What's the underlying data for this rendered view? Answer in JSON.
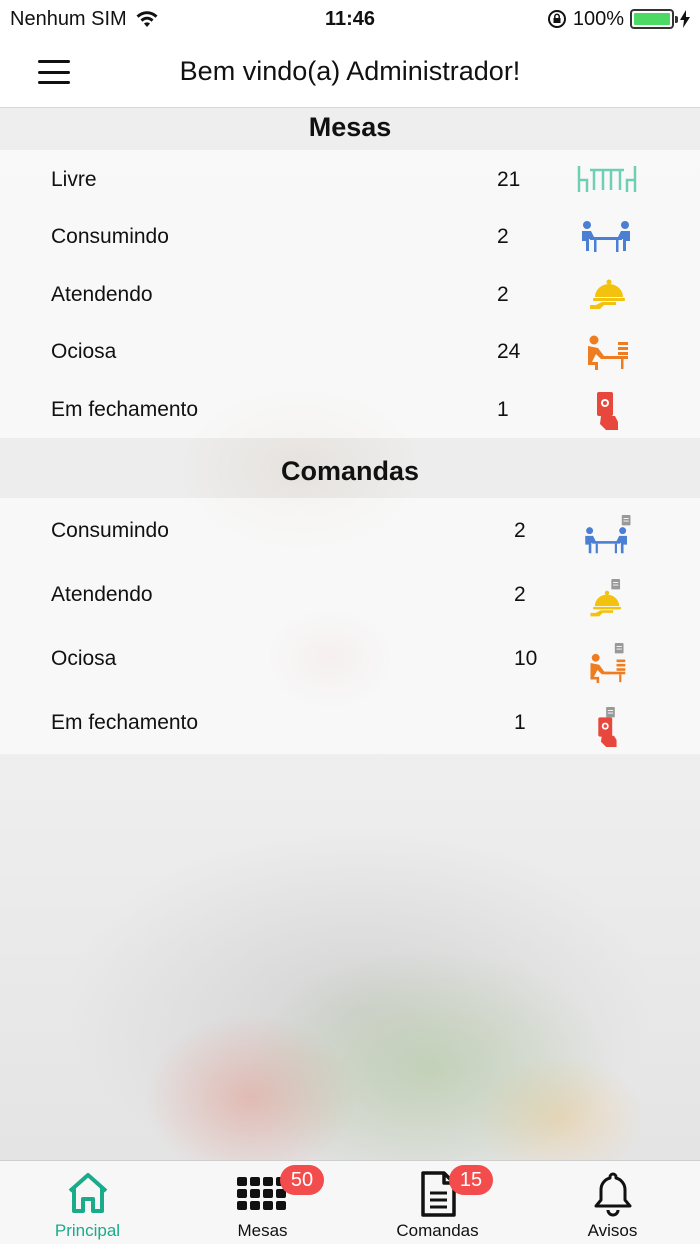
{
  "status_bar": {
    "carrier": "Nenhum SIM",
    "time": "11:46",
    "battery": "100%"
  },
  "header": {
    "title": "Bem vindo(a) Administrador!"
  },
  "mesas": {
    "title": "Mesas",
    "rows": [
      {
        "label": "Livre",
        "count": "21",
        "icon": "free-table-icon",
        "color": "#6fcfb3"
      },
      {
        "label": "Consumindo",
        "count": "2",
        "icon": "people-eating-icon",
        "color": "#4a7fd4"
      },
      {
        "label": "Atendendo",
        "count": "2",
        "icon": "service-cloche-icon",
        "color": "#f2c20f"
      },
      {
        "label": "Ociosa",
        "count": "24",
        "icon": "idle-person-icon",
        "color": "#ee7d22"
      },
      {
        "label": "Em fechamento",
        "count": "1",
        "icon": "payment-hand-icon",
        "color": "#e8483c"
      }
    ]
  },
  "comandas": {
    "title": "Comandas",
    "rows": [
      {
        "label": "Consumindo",
        "count": "2",
        "icon": "people-eating-order-icon",
        "color": "#4a7fd4"
      },
      {
        "label": "Atendendo",
        "count": "2",
        "icon": "service-cloche-order-icon",
        "color": "#f2c20f"
      },
      {
        "label": "Ociosa",
        "count": "10",
        "icon": "idle-person-order-icon",
        "color": "#ee7d22"
      },
      {
        "label": "Em fechamento",
        "count": "1",
        "icon": "payment-hand-order-icon",
        "color": "#e8483c"
      }
    ]
  },
  "tab_bar": {
    "tabs": [
      {
        "label": "Principal",
        "icon": "home-icon",
        "active": true
      },
      {
        "label": "Mesas",
        "icon": "grid-icon",
        "badge": "50"
      },
      {
        "label": "Comandas",
        "icon": "document-icon",
        "badge": "15"
      },
      {
        "label": "Avisos",
        "icon": "bell-icon"
      }
    ],
    "active_color": "#1aab8a",
    "badge_color": "#f24c4c"
  }
}
